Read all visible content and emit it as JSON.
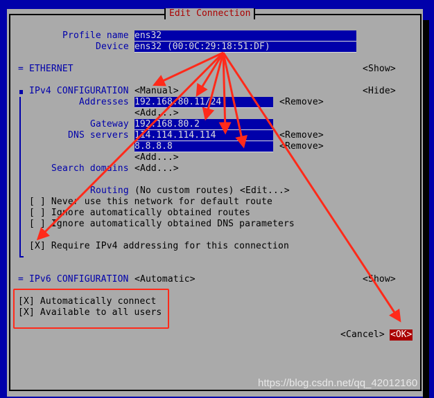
{
  "dialog": {
    "title": "Edit Connection",
    "profile_name_label": "Profile name",
    "profile_name_value": "ens32",
    "device_label": "Device",
    "device_value": "ens32 (00:0C:29:18:51:DF)"
  },
  "ethernet": {
    "label": "= ETHERNET",
    "toggle": "<Show>"
  },
  "ipv4": {
    "label": "IPv4 CONFIGURATION",
    "method": "<Manual>",
    "toggle": "<Hide>",
    "addresses_label": "Addresses",
    "addresses": [
      "192.168.80.11/24"
    ],
    "remove_label": "<Remove>",
    "add_label": "<Add...>",
    "gateway_label": "Gateway",
    "gateway_value": "192.168.80.2",
    "dns_label": "DNS servers",
    "dns_servers": [
      "114.114.114.114",
      "8.8.8.8"
    ],
    "search_domains_label": "Search domains",
    "routing_label": "Routing",
    "routing_value": "(No custom routes)",
    "routing_edit": "<Edit...>",
    "checkboxes": [
      {
        "mark": "[ ]",
        "label": "Never use this network for default route",
        "checked": false
      },
      {
        "mark": "[ ]",
        "label": "Ignore automatically obtained routes",
        "checked": false
      },
      {
        "mark": "[ ]",
        "label": "Ignore automatically obtained DNS parameters",
        "checked": false
      },
      {
        "mark": "[X]",
        "label": "Require IPv4 addressing for this connection",
        "checked": true
      }
    ]
  },
  "ipv6": {
    "label": "= IPv6 CONFIGURATION",
    "method": "<Automatic>",
    "toggle": "<Show>"
  },
  "general": {
    "checkboxes": [
      {
        "mark": "[X]",
        "label": "Automatically connect",
        "checked": true
      },
      {
        "mark": "[X]",
        "label": "Available to all users",
        "checked": true
      }
    ]
  },
  "buttons": {
    "cancel": "<Cancel>",
    "ok": "<OK>"
  },
  "annotations": {
    "arrow_color": "#ff2a1a",
    "box_color": "#ff2a1a"
  },
  "watermark": "https://blog.csdn.net/qq_42012160",
  "colors": {
    "background": "#0000aa",
    "dialog": "#aaaaaa",
    "label_blue": "#0000aa",
    "title_red": "#aa0000",
    "ok_bg": "#aa0000"
  }
}
